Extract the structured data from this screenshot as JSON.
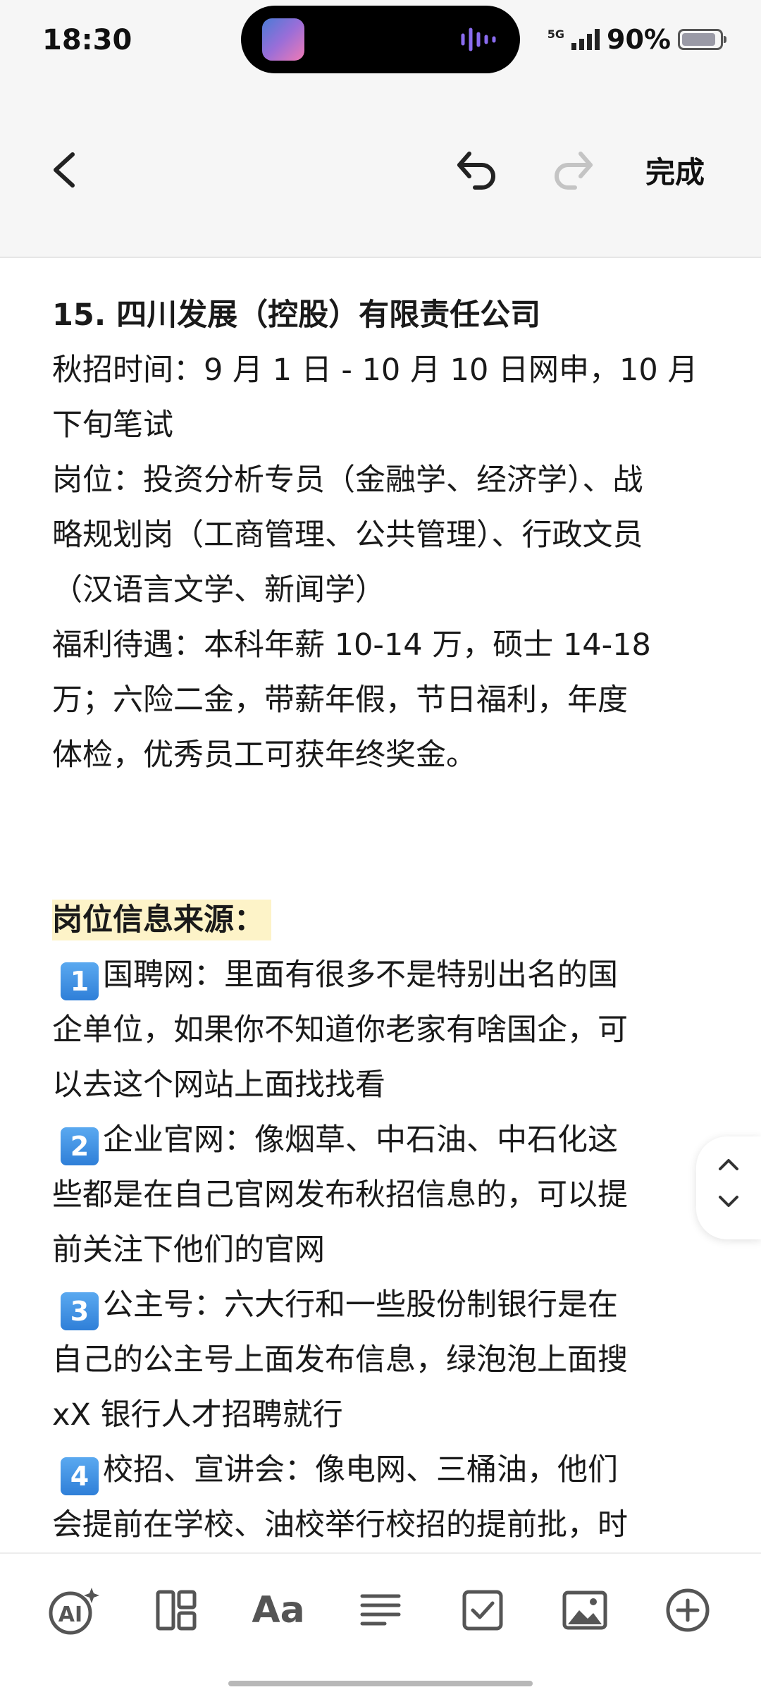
{
  "status_bar": {
    "time": "18:30",
    "network": "5G",
    "battery_percent": "90%",
    "battery_level": 0.9
  },
  "toolbar": {
    "done_label": "完成"
  },
  "content": {
    "lines": [
      "15. 四川发展（控股）有限责任公司",
      "秋招时间：9 月 1 日 - 10 月 10 日网申，10 月",
      "下旬笔试",
      "岗位：投资分析专员（金融学、经济学）、战",
      "略规划岗（工商管理、公共管理）、行政文员",
      "（汉语言文学、新闻学）",
      "福利待遇：本科年薪 10-14 万，硕士 14-18",
      "万；六险二金，带薪年假，节日福利，年度",
      "体检，优秀员工可获年终奖金。"
    ],
    "source_heading": "岗位信息来源：",
    "items": [
      {
        "num": "1",
        "first": "国聘网：里面有很多不是特别出名的国",
        "rest": [
          "企单位，如果你不知道你老家有啥国企，可",
          "以去这个网站上面找找看"
        ]
      },
      {
        "num": "2",
        "first": "企业官网：像烟草、中石油、中石化这",
        "rest": [
          "些都是在自己官网发布秋招信息的，可以提",
          "前关注下他们的官网"
        ]
      },
      {
        "num": "3",
        "first": "公主号：六大行和一些股份制银行是在",
        "rest": [
          "自己的公主号上面发布信息，绿泡泡上面搜",
          "xX 银行人才招聘就行"
        ]
      },
      {
        "num": "4",
        "first": "校招、宣讲会：像电网、三桶油，他们",
        "rest": [
          "会提前在学校、油校举行校招的提前批，时"
        ]
      }
    ]
  },
  "icons": {
    "back": "chevron-left-icon",
    "undo": "undo-icon",
    "redo": "redo-icon",
    "bottom": [
      "ai-icon",
      "layout-icon",
      "text-format-icon",
      "align-icon",
      "checkbox-icon",
      "image-icon",
      "add-circle-icon"
    ]
  },
  "bottom_bar": {
    "text_format_label": "Aa"
  }
}
